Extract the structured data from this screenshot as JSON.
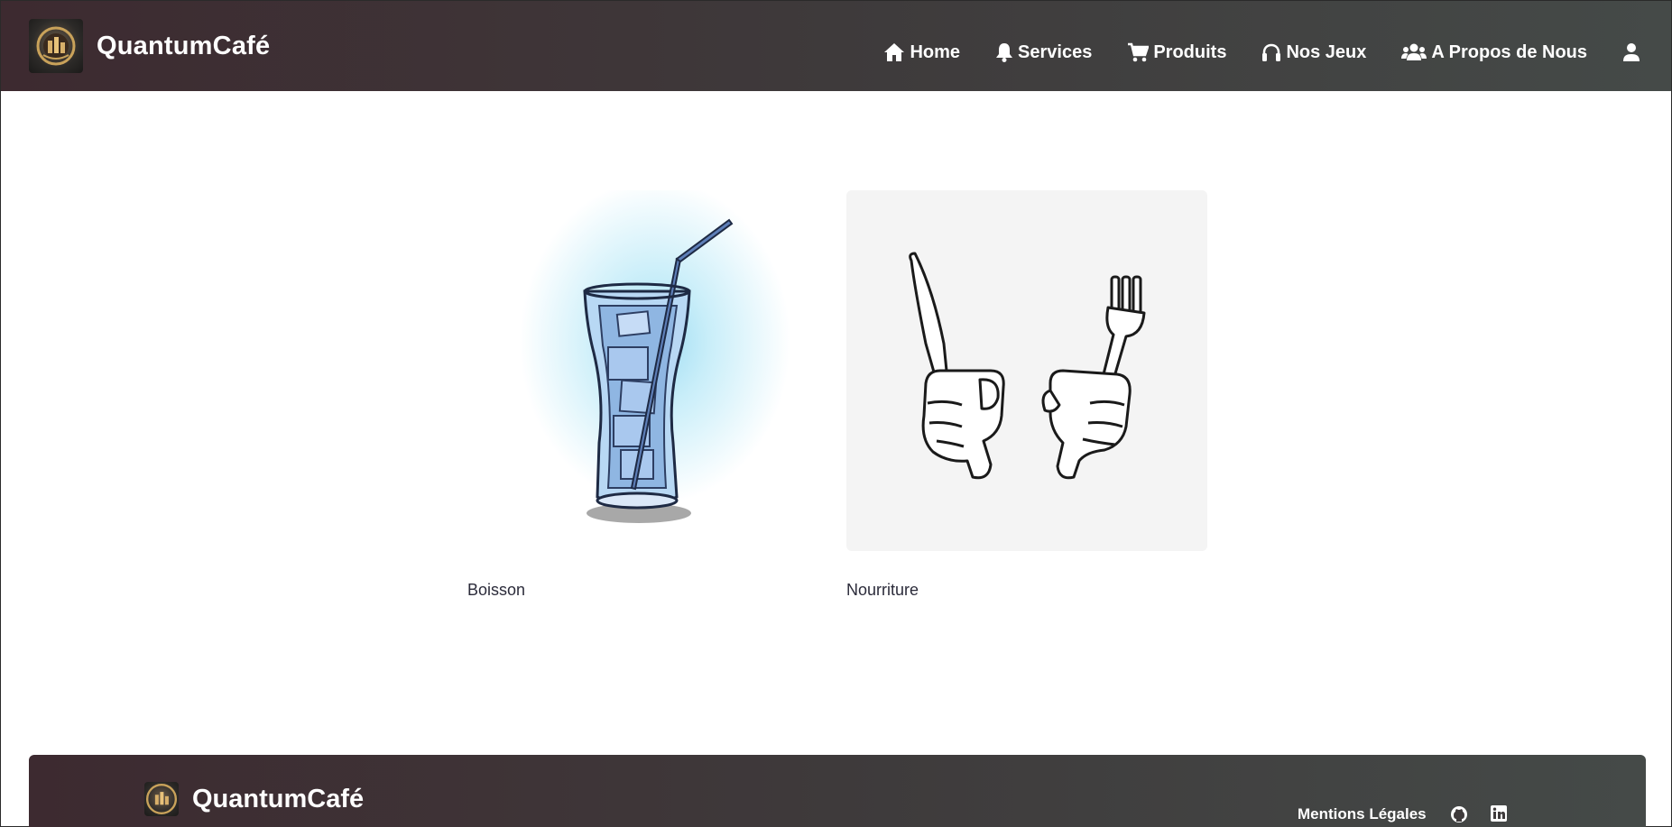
{
  "navbar": {
    "brand": "QuantumCafé",
    "items": [
      {
        "label": "Home",
        "icon": "home-icon"
      },
      {
        "label": "Services",
        "icon": "bell-icon"
      },
      {
        "label": "Produits",
        "icon": "cart-icon"
      },
      {
        "label": "Nos Jeux",
        "icon": "headphones-icon"
      },
      {
        "label": "A Propos de Nous",
        "icon": "users-icon"
      }
    ],
    "user_icon": "user-icon"
  },
  "categories": [
    {
      "label": "Boisson",
      "image": "iced-drink-glass"
    },
    {
      "label": "Nourriture",
      "image": "hands-knife-fork"
    }
  ],
  "footer": {
    "brand": "QuantumCafé",
    "mentions": "Mentions Légales",
    "icons": [
      "github-icon",
      "linkedin-icon"
    ]
  },
  "colors": {
    "header_gradient_start": "#3d2a30",
    "header_gradient_end": "#454a48",
    "text_light": "#ffffff",
    "label_text": "#2b2b3a"
  }
}
